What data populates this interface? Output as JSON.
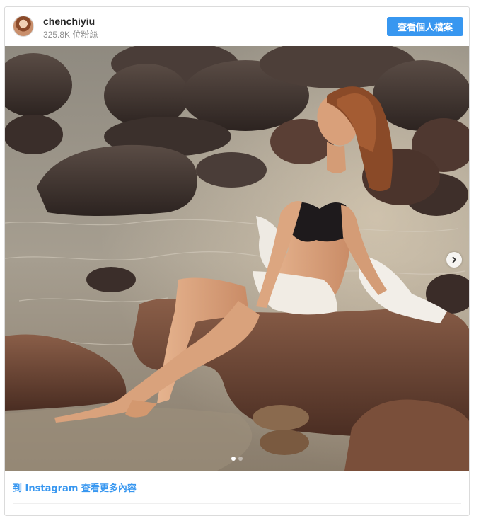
{
  "header": {
    "username": "chenchiyiu",
    "followers": "325.8K 位粉絲",
    "profile_button": "查看個人檔案"
  },
  "post": {
    "image_alt": "Woman in black bikini sitting on rocks by the sea",
    "carousel": {
      "current": 1,
      "total": 2
    }
  },
  "footer": {
    "view_more_link": "到 Instagram 查看更多內容"
  },
  "icons": {
    "avatar": "profile-avatar",
    "next": "chevron-right-icon"
  },
  "colors": {
    "accent": "#3897f0",
    "border": "#dbdbdb",
    "username": "#262626",
    "muted": "#8e8e8e"
  }
}
